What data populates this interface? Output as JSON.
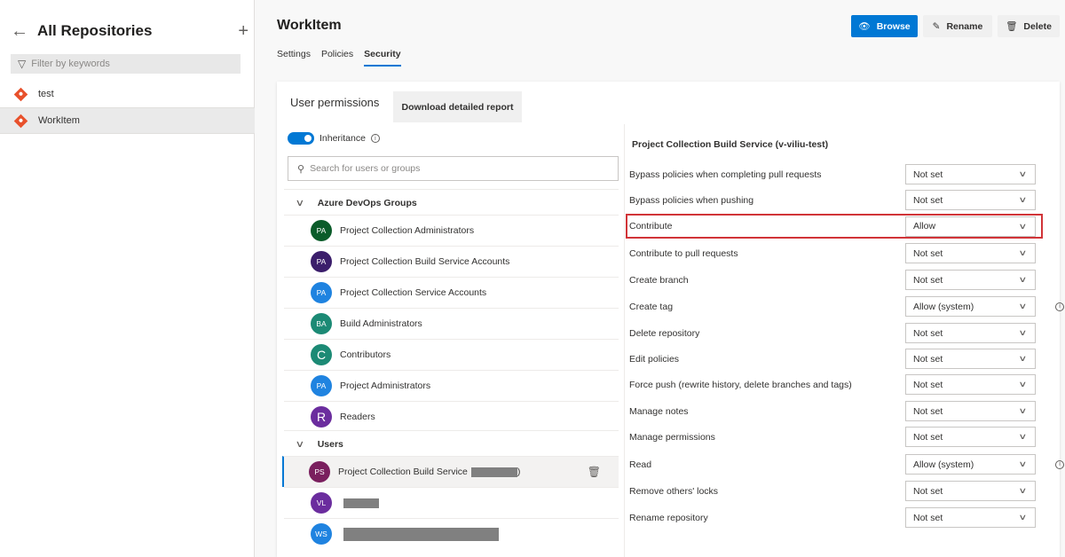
{
  "sidebar": {
    "back_icon": "←",
    "title": "All Repositories",
    "add_icon": "+",
    "filter_placeholder": "Filter by keywords",
    "repos": [
      {
        "name": "test"
      },
      {
        "name": "WorkItem"
      }
    ]
  },
  "header": {
    "title": "WorkItem",
    "tabs": [
      "Settings",
      "Policies",
      "Security"
    ],
    "active_tab": "Security",
    "browse_label": "Browse",
    "rename_label": "Rename",
    "delete_label": "Delete",
    "accent": "#0078d4"
  },
  "panel": {
    "user_permissions_label": "User permissions",
    "download_label": "Download detailed report",
    "inheritance_label": "Inheritance",
    "search_placeholder": "Search for users or groups",
    "group_heading": "Azure DevOps Groups",
    "groups": [
      {
        "initials": "PA",
        "name": "Project Collection Administrators",
        "color": "#0b5c2a"
      },
      {
        "initials": "PA",
        "name": "Project Collection Build Service Accounts",
        "color": "#3b1e6b"
      },
      {
        "initials": "PA",
        "name": "Project Collection Service Accounts",
        "color": "#1f83e0"
      },
      {
        "initials": "BA",
        "name": "Build Administrators",
        "color": "#1c8a75"
      },
      {
        "initials": "C",
        "name": "Contributors",
        "color": "#1c8a75"
      },
      {
        "initials": "PA",
        "name": "Project Administrators",
        "color": "#1f83e0"
      },
      {
        "initials": "R",
        "name": "Readers",
        "color": "#6b2d9e"
      }
    ],
    "users_heading": "Users",
    "users": [
      {
        "initials": "PS",
        "name": "Project Collection Build Service",
        "suffix": ")",
        "color": "#7a1f5e"
      },
      {
        "initials": "VL",
        "name": "",
        "suffix": "",
        "color": "#6b2d9e"
      },
      {
        "initials": "WS",
        "name": "",
        "suffix": "",
        "color": "#1f83e0"
      }
    ]
  },
  "permissions": {
    "title": "Project Collection Build Service (v-viliu-test)",
    "rows": [
      {
        "label": "Bypass policies when completing pull requests",
        "value": "Not set"
      },
      {
        "label": "Bypass policies when pushing",
        "value": "Not set"
      },
      {
        "label": "Contribute",
        "value": "Allow"
      },
      {
        "label": "Contribute to pull requests",
        "value": "Not set"
      },
      {
        "label": "Create branch",
        "value": "Not set"
      },
      {
        "label": "Create tag",
        "value": "Allow (system)"
      },
      {
        "label": "Delete repository",
        "value": "Not set"
      },
      {
        "label": "Edit policies",
        "value": "Not set"
      },
      {
        "label": "Force push (rewrite history, delete branches and tags)",
        "value": "Not set"
      },
      {
        "label": "Manage notes",
        "value": "Not set"
      },
      {
        "label": "Manage permissions",
        "value": "Not set"
      },
      {
        "label": "Read",
        "value": "Allow (system)"
      },
      {
        "label": "Remove others' locks",
        "value": "Not set"
      },
      {
        "label": "Rename repository",
        "value": "Not set"
      }
    ],
    "highlight_color": "#d13438"
  }
}
